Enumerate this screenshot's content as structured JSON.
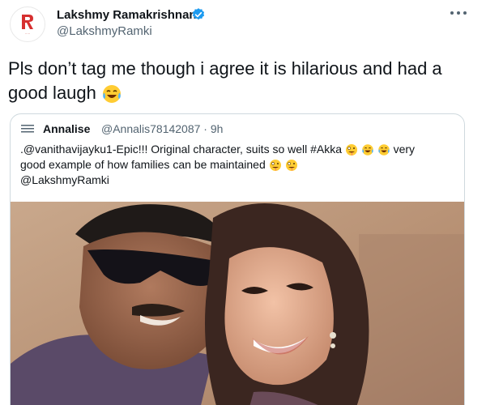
{
  "tweet": {
    "author_name": "Lakshmy Ramakrishnan",
    "handle": "@LakshmyRamki",
    "text": "Pls don’t tag me though i agree it is hilarious and had a good laugh",
    "emoji": "tears-of-joy",
    "accent_color": "#1d9bf0"
  },
  "quoted": {
    "author_name": "Annalise",
    "handle_time": "@Annalis78142087 · 9h",
    "lines": [
      ".@vanithavijayku1-Epic!!! Original character, suits so well #Akka",
      "very",
      "good example of how families can be maintained",
      "@LakshmyRamki"
    ],
    "emoji": [
      "zany-face",
      "tears-of-joy",
      "tears-of-joy",
      "zany-face",
      "zany-face"
    ]
  },
  "photo": {
    "subject": "man-in-sunglasses-and-woman-smiling"
  }
}
